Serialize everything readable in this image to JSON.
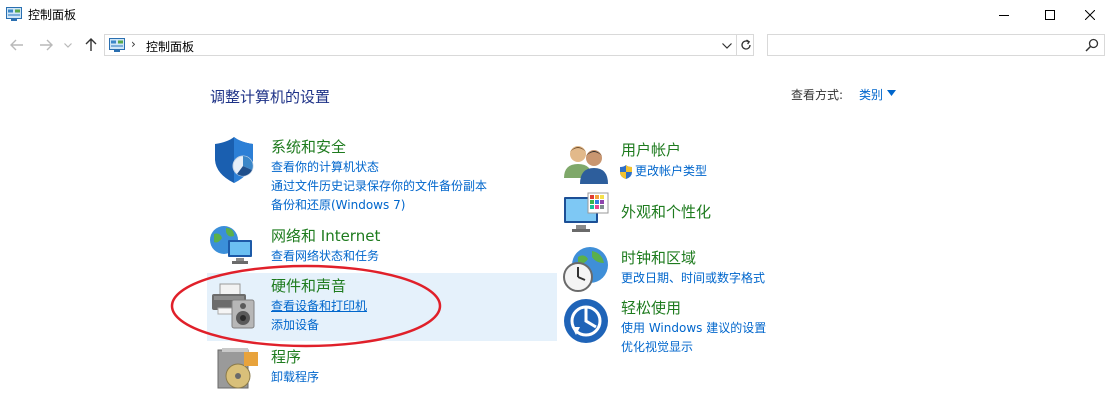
{
  "window": {
    "title": "控制面板",
    "icon": "control-panel-icon"
  },
  "address_bar": {
    "path": "控制面板",
    "separator": "›"
  },
  "search": {
    "placeholder": ""
  },
  "main": {
    "heading": "调整计算机的设置",
    "view_by_label": "查看方式:",
    "view_by_value": "类别"
  },
  "categories_left": [
    {
      "title": "系统和安全",
      "icon": "shield-icon",
      "links": [
        "查看你的计算机状态",
        "通过文件历史记录保存你的文件备份副本",
        "备份和还原(Windows 7)"
      ]
    },
    {
      "title": "网络和 Internet",
      "icon": "network-globe-icon",
      "links": [
        "查看网络状态和任务"
      ]
    },
    {
      "title": "硬件和声音",
      "icon": "printer-speaker-icon",
      "links": [
        "查看设备和打印机",
        "添加设备"
      ]
    },
    {
      "title": "程序",
      "icon": "programs-disc-icon",
      "links": [
        "卸载程序"
      ]
    }
  ],
  "categories_right": [
    {
      "title": "用户帐户",
      "icon": "users-icon",
      "links": [
        "更改帐户类型"
      ]
    },
    {
      "title": "外观和个性化",
      "icon": "monitor-palette-icon",
      "links": []
    },
    {
      "title": "时钟和区域",
      "icon": "clock-globe-icon",
      "links": [
        "更改日期、时间或数字格式"
      ]
    },
    {
      "title": "轻松使用",
      "icon": "ease-of-access-icon",
      "links": [
        "使用 Windows 建议的设置",
        "优化视觉显示"
      ]
    }
  ],
  "colors": {
    "heading": "#1e3287",
    "category_title": "#1e7b1e",
    "link": "#0066cc",
    "hover_panel": "#e5f1fb",
    "annotation": "#e0202a"
  }
}
